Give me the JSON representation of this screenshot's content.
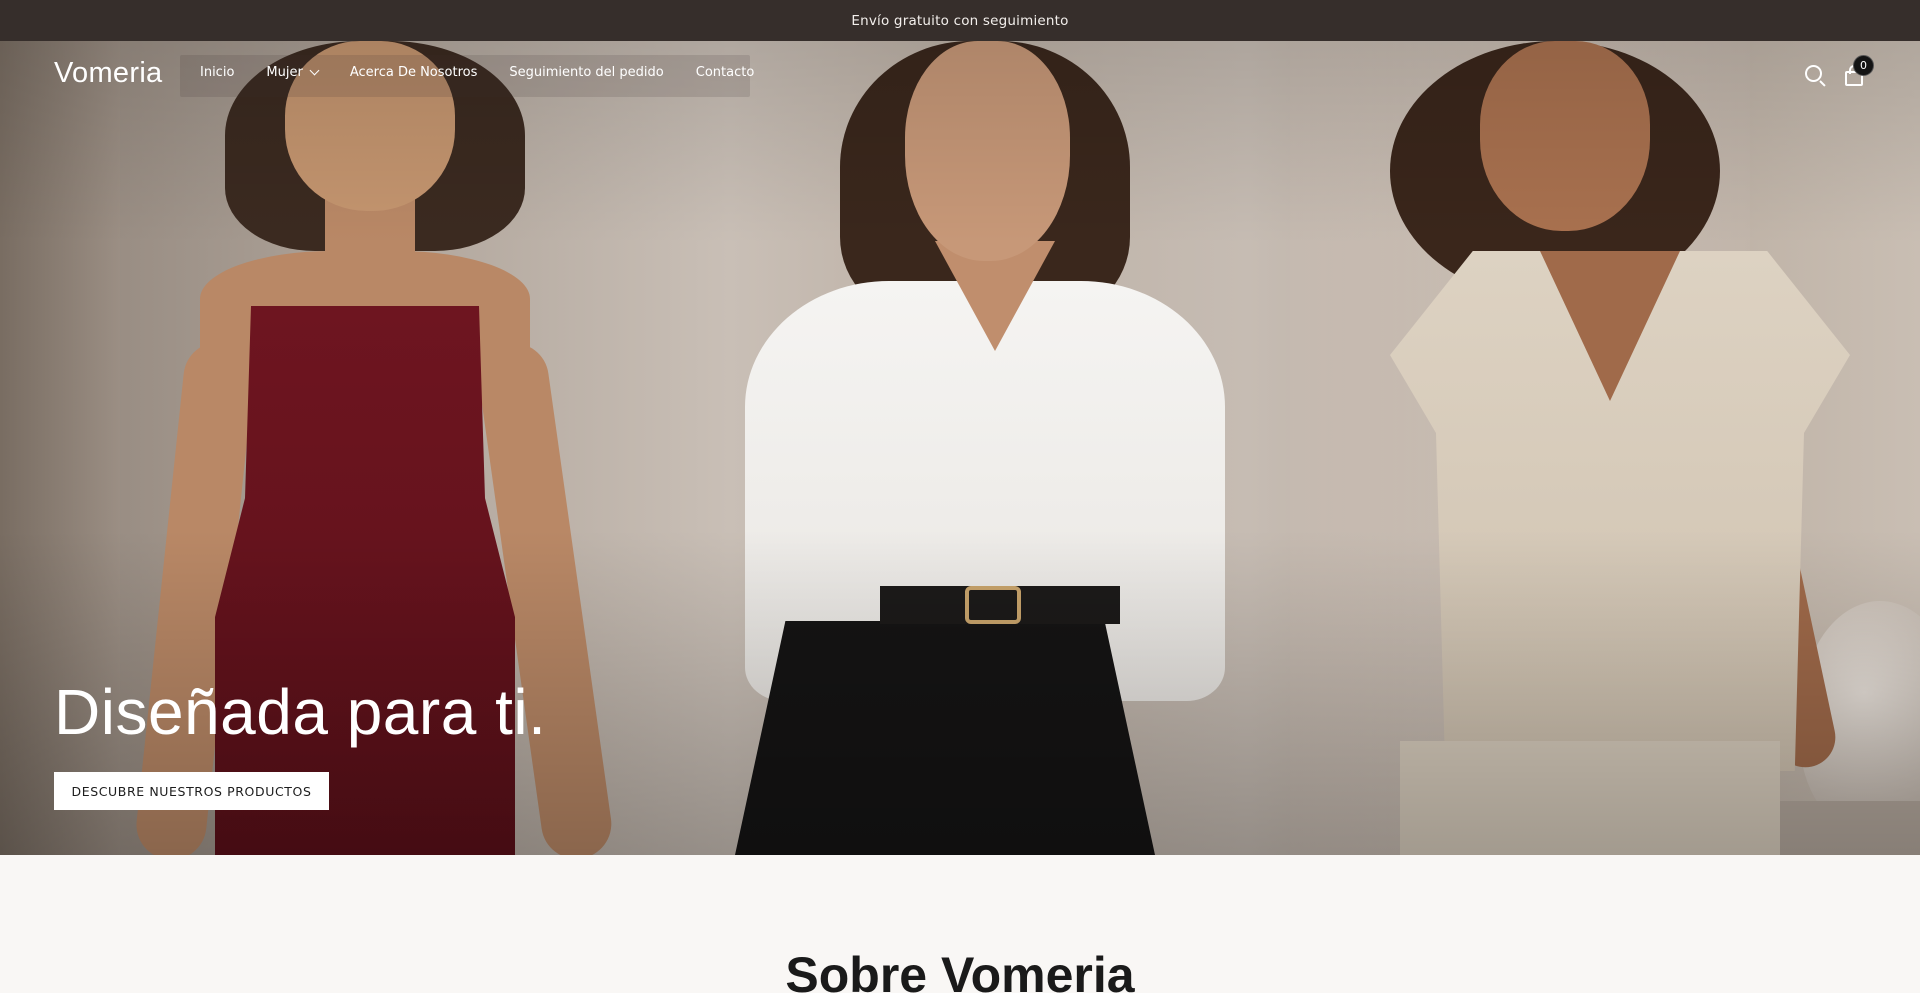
{
  "announcement": {
    "text": "Envío gratuito con seguimiento"
  },
  "header": {
    "logo": "Vomeria",
    "nav": [
      {
        "label": "Inicio"
      },
      {
        "label": "Mujer",
        "has_dropdown": true
      },
      {
        "label": "Acerca De Nosotros"
      },
      {
        "label": "Seguimiento del pedido"
      },
      {
        "label": "Contacto"
      }
    ],
    "search_icon": "search-icon",
    "cart_icon": "shopping-bag-icon",
    "cart_count": "0"
  },
  "hero": {
    "title": "Diseñada para ti.",
    "cta_label": "DESCUBRE NUESTROS PRODUCTOS"
  },
  "about": {
    "title": "Sobre Vomeria"
  },
  "colors": {
    "announcement_bg": "#362e2b",
    "cta_bg": "#ffffff",
    "page_bg": "#f9f7f5"
  }
}
